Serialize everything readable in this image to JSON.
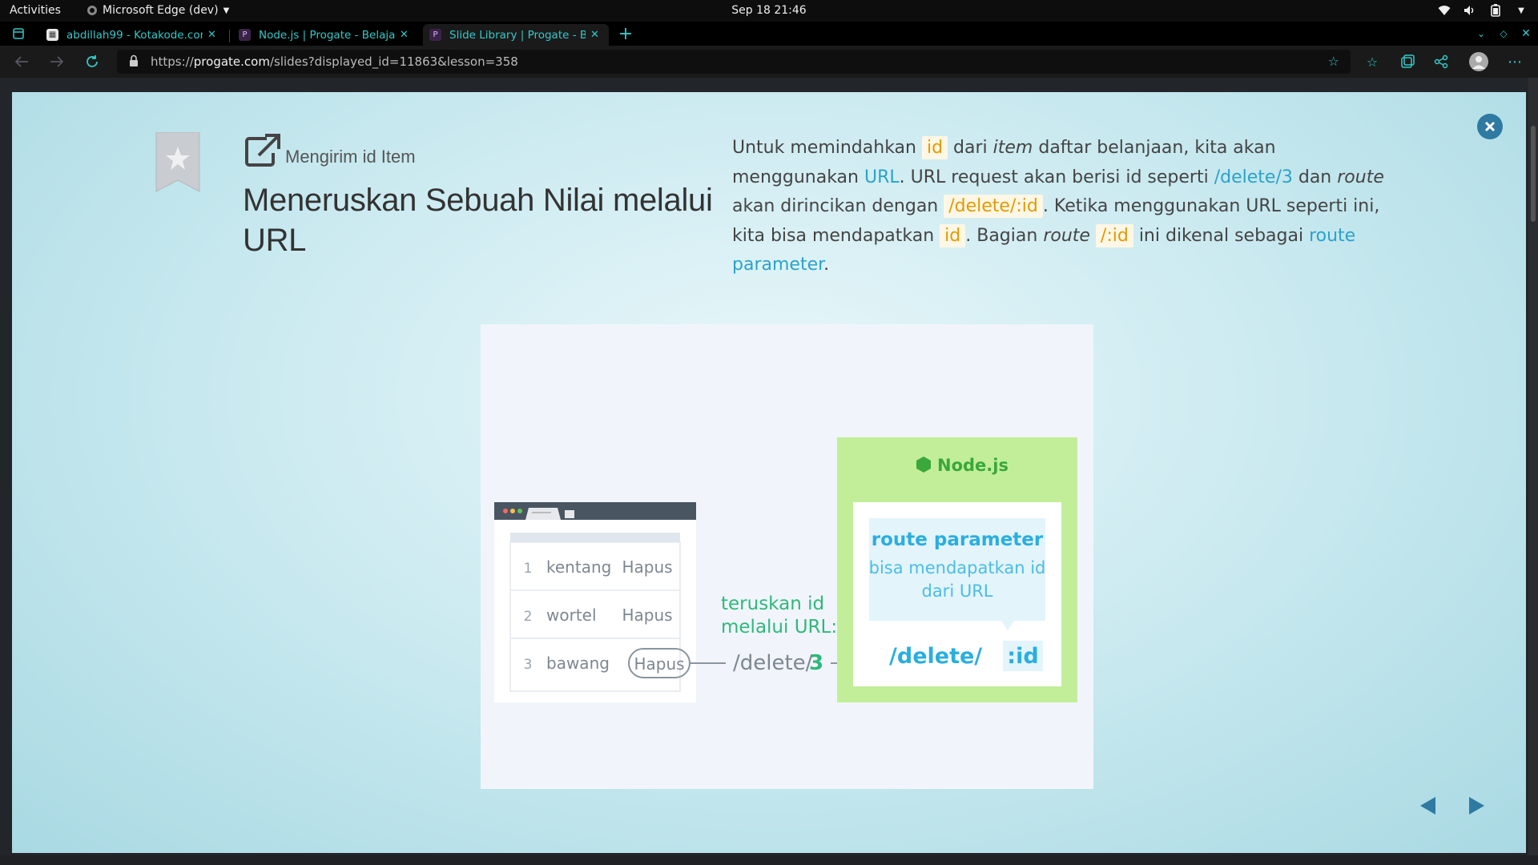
{
  "system_bar": {
    "activities": "Activities",
    "app_name": "Microsoft Edge (dev)",
    "clock": "Sep 18  21:46"
  },
  "tabs": [
    {
      "title": "abdillah99 - Kotakode.com",
      "active": false
    },
    {
      "title": "Node.js | Progate - Belajar",
      "active": false
    },
    {
      "title": "Slide Library | Progate - Belajar",
      "active": true
    }
  ],
  "address_bar": {
    "scheme": "https://",
    "host": "progate.com",
    "path": "/slides?displayed_id=11863&lesson=358"
  },
  "slide": {
    "subtitle": "Mengirim id Item",
    "title": "Meneruskan Sebuah Nilai melalui URL",
    "description": {
      "p1": "Untuk memindahkan ",
      "c1": "id",
      "p2": " dari ",
      "i1": "item",
      "p3": " daftar belanjaan, kita akan menggunakan ",
      "l1": "URL",
      "p4": ". URL request akan berisi id seperti ",
      "l2": "/delete/3",
      "p5": " dan ",
      "i2": "route",
      "p6": " akan dirincikan dengan ",
      "c2": "/delete/:id",
      "p7": ". Ketika menggunakan URL seperti ini, kita bisa mendapatkan ",
      "c3": "id",
      "p8": ". Bagian ",
      "i3": "route",
      "p9": " ",
      "c4": "/:id",
      "p10": " ini dikenal sebagai ",
      "l3": "route parameter",
      "p11": "."
    }
  },
  "illustration": {
    "list_items": [
      {
        "num": "1",
        "name": "kentang",
        "action": "Hapus"
      },
      {
        "num": "2",
        "name": "wortel",
        "action": "Hapus"
      },
      {
        "num": "3",
        "name": "bawang",
        "action": "Hapus"
      }
    ],
    "arrow_label_line1": "teruskan id",
    "arrow_label_line2": "melalui URL:",
    "url_prefix": "/delete/",
    "url_id": "3",
    "server_label": "Node.js",
    "route_param_title": "route parameter",
    "route_param_desc_line1": "bisa mendapatkan id",
    "route_param_desc_line2": "dari URL",
    "route_prefix": "/delete/",
    "route_param": ":id"
  },
  "colors": {
    "accent_blue": "#2aa3c9",
    "code_orange": "#e39a00",
    "node_green": "#c2ee9a",
    "teal_text": "#35c8c8"
  }
}
